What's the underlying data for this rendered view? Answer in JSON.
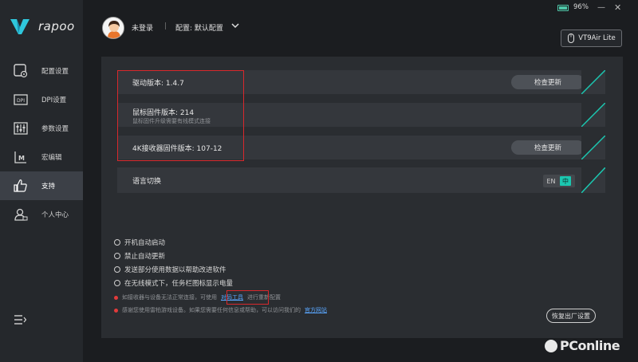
{
  "app": {
    "brand": "rapoo",
    "battery_percent": "96%",
    "battery_level": 0.96,
    "minimize_glyph": "—",
    "close_glyph": "✕",
    "device_name": "VT9Air Lite"
  },
  "header": {
    "login": "未登录",
    "separator": "|",
    "config": "配置: 默认配置"
  },
  "sidebar": {
    "items": [
      {
        "label": "配置设置",
        "icon": "config-icon"
      },
      {
        "label": "DPI设置",
        "icon": "dpi-icon"
      },
      {
        "label": "参数设置",
        "icon": "sliders-icon"
      },
      {
        "label": "宏编辑",
        "icon": "macro-icon"
      },
      {
        "label": "支持",
        "icon": "thumbs-up-icon",
        "active": true
      },
      {
        "label": "个人中心",
        "icon": "user-icon"
      }
    ]
  },
  "support": {
    "driver_version": "驱动版本: 1.4.7",
    "mouse_firmware": "鼠标固件版本:  214",
    "mouse_firmware_sub": "鼠标固件升级需要有线模式连接",
    "receiver_firmware": "4K接收器固件版本:  107-12",
    "check_update": "检查更新",
    "language_label": "语言切换",
    "lang_en": "EN",
    "lang_zh": "中"
  },
  "options": [
    "开机自动启动",
    "禁止自动更新",
    "发送部分使用数据以帮助改进软件",
    "在无线模式下，任务栏图标显示电量"
  ],
  "notes": {
    "pair_prefix": "如接收器与设备无法正常连接，可使用",
    "pair_link": "对码工具",
    "pair_suffix": "进行重新配置",
    "thanks_prefix": "感谢您使用雷柏游戏设备。如果您需要任何信息或帮助，可以访问我们的",
    "thanks_link": "官方网站"
  },
  "reset_label": "恢复出厂设置",
  "watermark": "PConline",
  "colors": {
    "accent": "#1bc7b0",
    "highlight_box": "#d8282c",
    "link": "#5aa7ff"
  }
}
